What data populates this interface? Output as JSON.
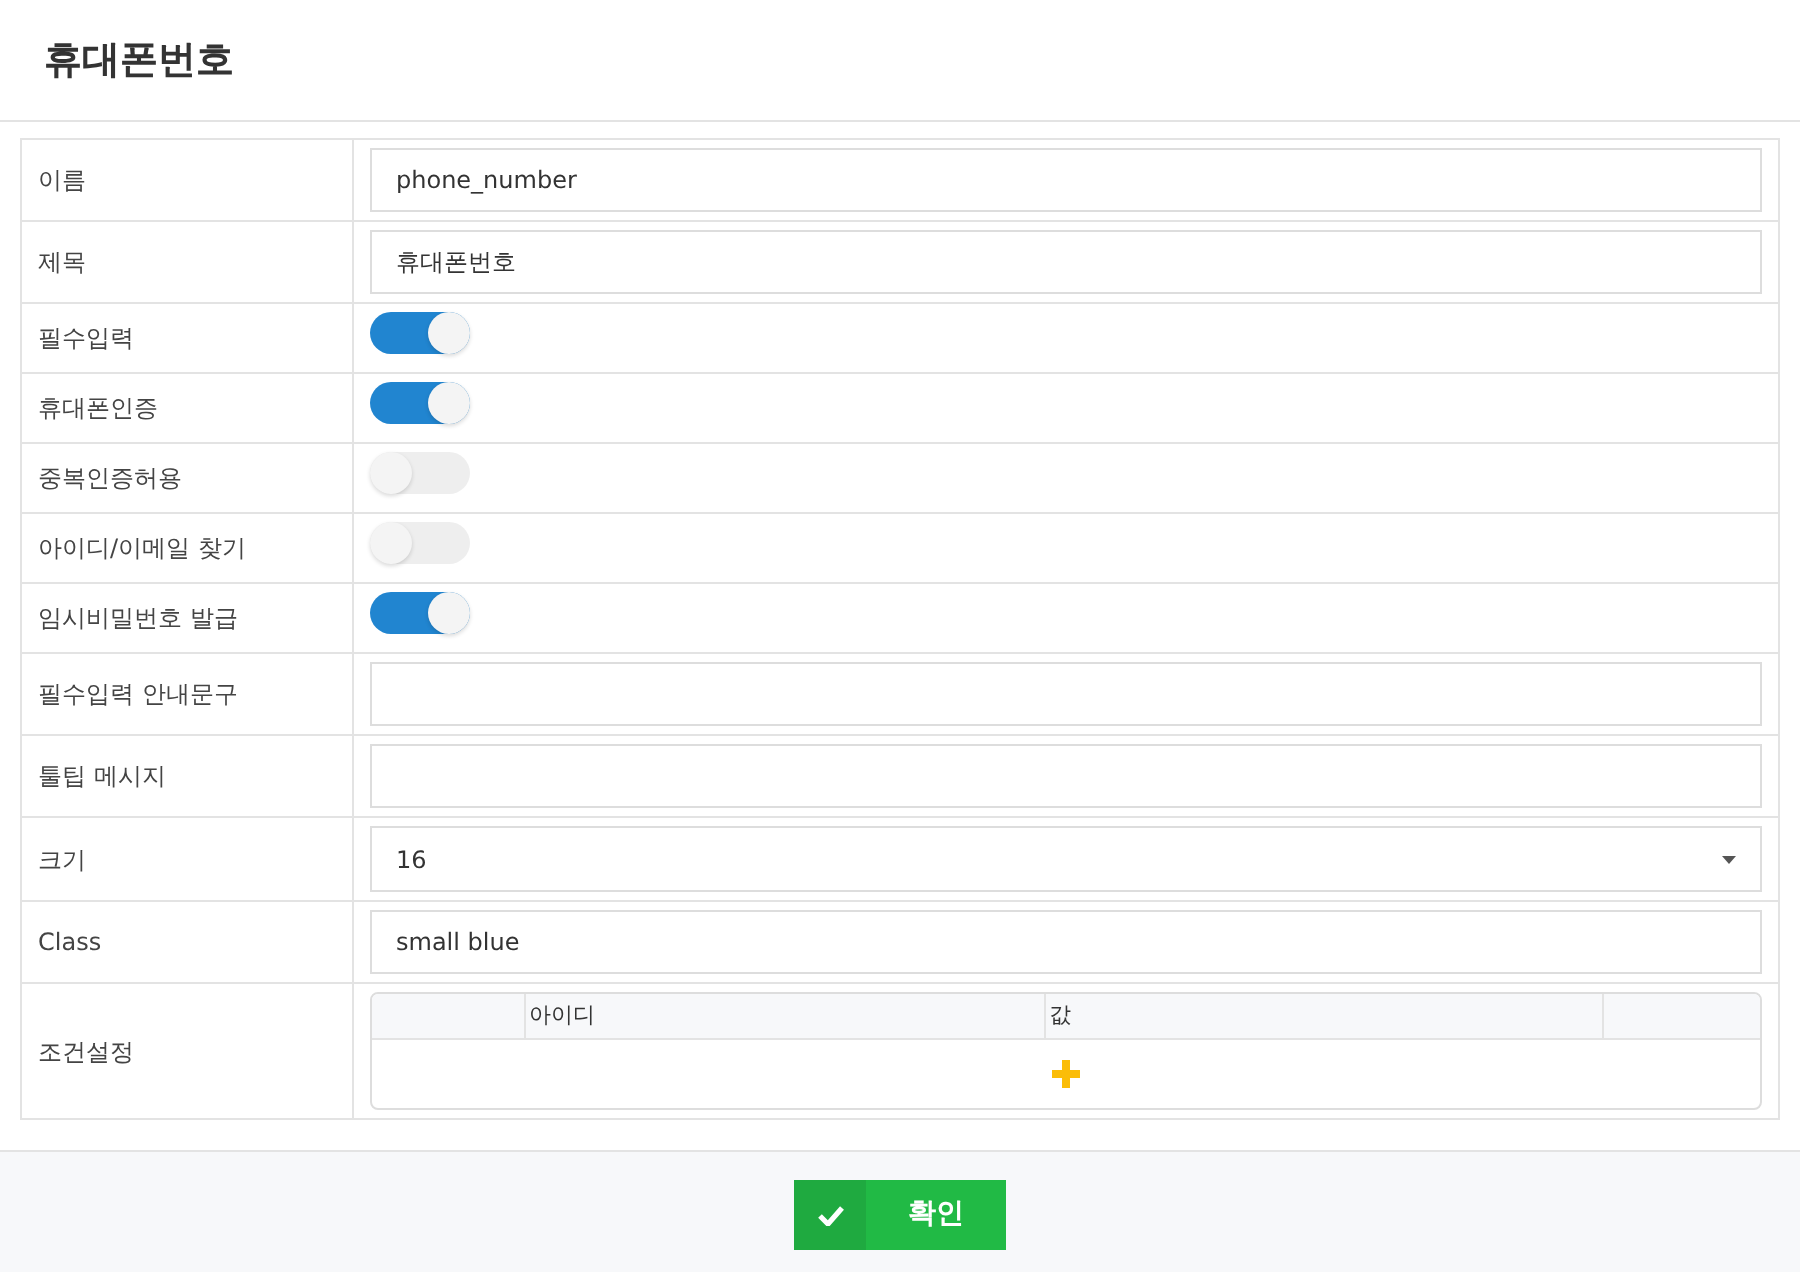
{
  "title": "휴대폰번호",
  "fields": [
    {
      "label": "이름",
      "kind": "text",
      "value": "phone_number"
    },
    {
      "label": "제목",
      "kind": "text",
      "value": "휴대폰번호"
    },
    {
      "label": "필수입력",
      "kind": "toggle",
      "on": true
    },
    {
      "label": "휴대폰인증",
      "kind": "toggle",
      "on": true
    },
    {
      "label": "중복인증허용",
      "kind": "toggle",
      "on": false
    },
    {
      "label": "아이디/이메일 찾기",
      "kind": "toggle",
      "on": false
    },
    {
      "label": "임시비밀번호 발급",
      "kind": "toggle",
      "on": true
    },
    {
      "label": "필수입력 안내문구",
      "kind": "text"
    },
    {
      "label": "툴팁 메시지",
      "kind": "text"
    },
    {
      "label": "크기",
      "kind": "select",
      "value": "16"
    },
    {
      "label": "Class",
      "kind": "text",
      "value": "small blue"
    },
    {
      "label": "조건설정",
      "kind": "grid",
      "columns": [
        "아이디",
        "값"
      ]
    }
  ],
  "confirm_button": "확인"
}
